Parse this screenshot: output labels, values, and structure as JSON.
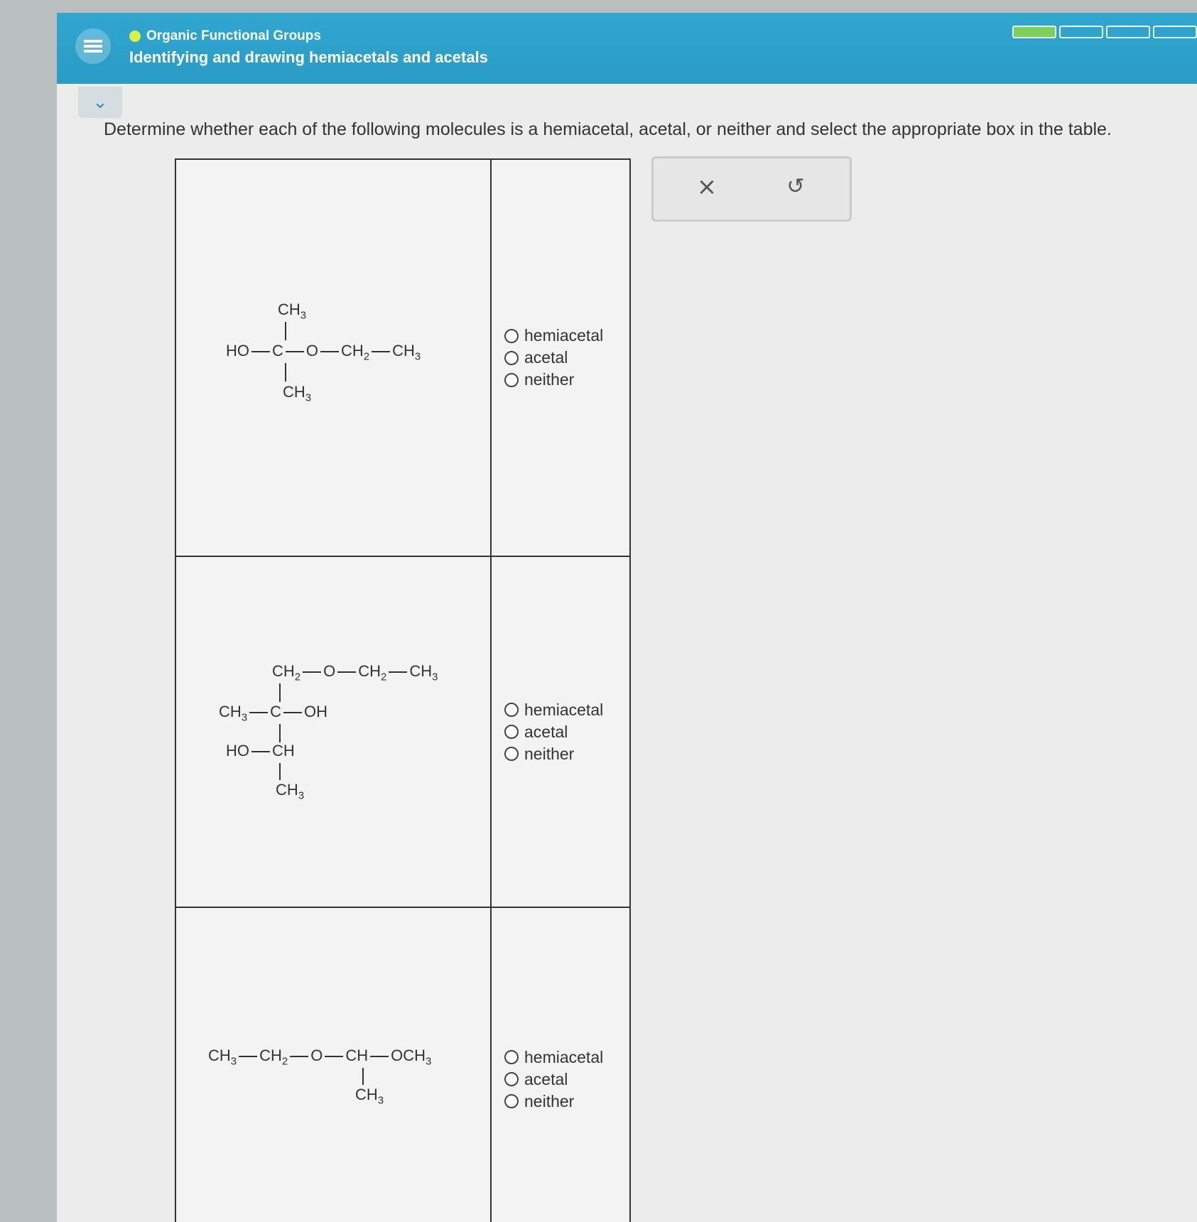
{
  "header": {
    "topic": "Organic Functional Groups",
    "title": "Identifying and drawing hemiacetals and acetals",
    "progress": {
      "filled": 1,
      "total": 4
    }
  },
  "instructions": "Determine whether each of the following molecules is a hemiacetal, acetal, or neither and select the appropriate box in the table.",
  "options": [
    "hemiacetal",
    "acetal",
    "neither"
  ],
  "molecules": {
    "m1": {
      "top": "CH3",
      "main_left": "HO",
      "center": "C",
      "o": "O",
      "ch2": "CH2",
      "ch3": "CH3",
      "bottom": "CH3"
    },
    "m2": {
      "top_ch2": "CH2",
      "o": "O",
      "ch2b": "CH2",
      "ch3a": "CH3",
      "left_ch3": "CH3",
      "center": "C",
      "oh": "OH",
      "ho": "HO",
      "ch": "CH",
      "bottom": "CH3"
    },
    "m3": {
      "ch3": "CH3",
      "ch2": "CH2",
      "o": "O",
      "ch": "CH",
      "och3": "OCH3",
      "bottom": "CH3"
    }
  },
  "actions": {
    "clear": "×",
    "undo": "↺"
  },
  "colors": {
    "header": "#2a9bc4",
    "progress_fill": "#7dd05a",
    "topic_dot": "#d9ef4a"
  }
}
